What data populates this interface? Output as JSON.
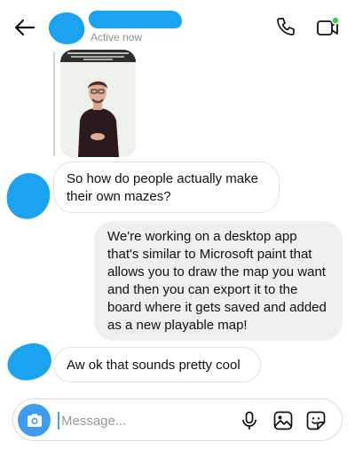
{
  "header": {
    "status": "Active now",
    "icons": {
      "back": "arrow-left-icon",
      "call": "phone-icon",
      "video": "video-camera-icon"
    },
    "online_dot_color": "#3ccf4e"
  },
  "redaction_color": "#1aa3ee",
  "shared_photo": {
    "kind": "person-photo"
  },
  "messages": [
    {
      "direction": "incoming",
      "text": "So how do people actually make their own mazes?"
    },
    {
      "direction": "outgoing",
      "text": "We're working on a desktop app that's similar to Microsoft paint that allows you to draw the map you want and then you can export it to the board where it gets saved and added as a new playable map!"
    },
    {
      "direction": "incoming",
      "text": "Aw ok that sounds pretty cool"
    }
  ],
  "composer": {
    "placeholder": "Message...",
    "value": "",
    "icons": {
      "camera": "camera-icon",
      "mic": "microphone-icon",
      "gallery": "gallery-icon",
      "sticker": "sticker-icon"
    },
    "camera_color": "#3d9cf0"
  }
}
